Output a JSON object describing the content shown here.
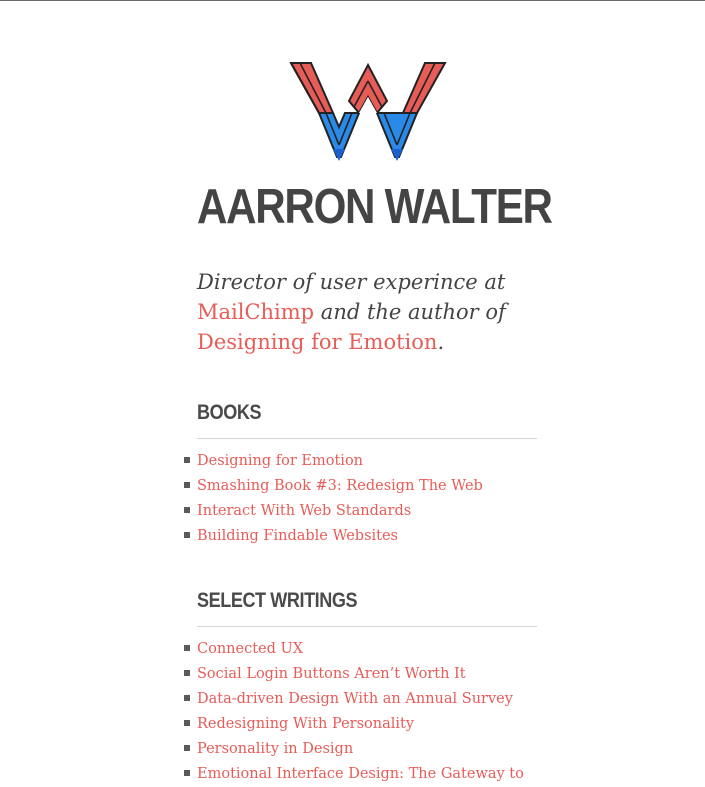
{
  "site": {
    "title": "AARRON WALTER",
    "logo_icon": "w-monogram-logo",
    "colors": {
      "accent_red": "#e85c57",
      "accent_blue": "#1a6fe0",
      "text_dark": "#444444"
    }
  },
  "intro": {
    "part1": "Director of user experince at ",
    "link1": "MailChimp",
    "part2": " and the author of ",
    "link2": "Designing for Emotion",
    "part3": "."
  },
  "books": {
    "heading": "BOOKS",
    "items": [
      "Designing for Emotion",
      "Smashing Book #3: Redesign The Web",
      "Interact With Web Standards",
      "Building Findable Websites"
    ]
  },
  "writings": {
    "heading": "SELECT WRITINGS",
    "items": [
      "Connected UX",
      "Social Login Buttons Aren’t Worth It",
      "Data-driven Design With an Annual Survey",
      "Redesigning With Personality",
      "Personality in Design",
      "Emotional Interface Design: The Gateway to"
    ]
  }
}
